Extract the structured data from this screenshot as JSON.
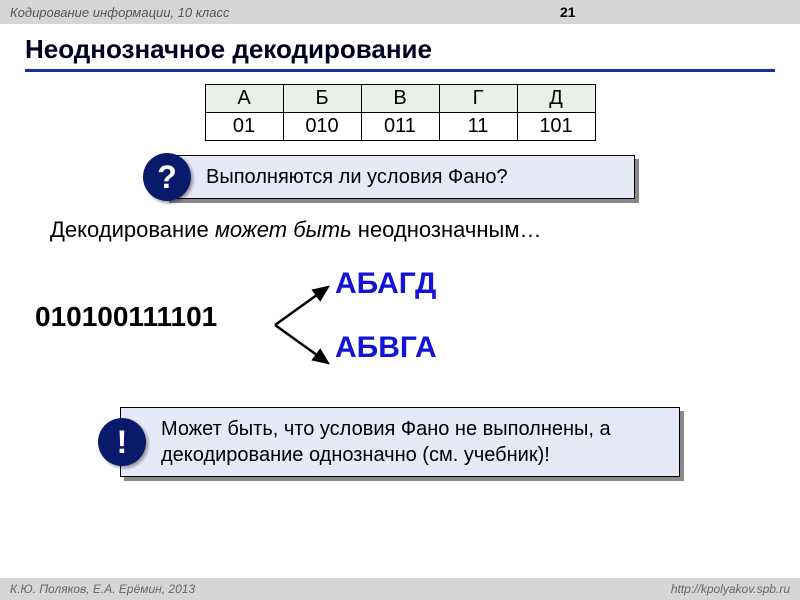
{
  "header": {
    "breadcrumb": "Кодирование информации, 10 класс",
    "page_number": "21"
  },
  "title": "Неоднозначное декодирование",
  "code_table": {
    "letters": [
      "А",
      "Б",
      "В",
      "Г",
      "Д"
    ],
    "codes": [
      "01",
      "010",
      "011",
      "11",
      "101"
    ]
  },
  "question_callout": {
    "badge": "?",
    "text": "Выполняются ли условия Фано?"
  },
  "subtitle": {
    "before": "Декодирование ",
    "italic": "может быть",
    "after": " неоднозначным…"
  },
  "decoding": {
    "bitstring": "010100111101",
    "result_top": "АБАГД",
    "result_bottom": "АБВГА"
  },
  "note_callout": {
    "badge": "!",
    "text": "Может быть, что условия Фано не выполнены, а декодирование однозначно (см. учебник)!"
  },
  "footer": {
    "left": "К.Ю. Поляков, Е.А. Ерёмин, 2013",
    "right": "http://kpolyakov.spb.ru"
  }
}
